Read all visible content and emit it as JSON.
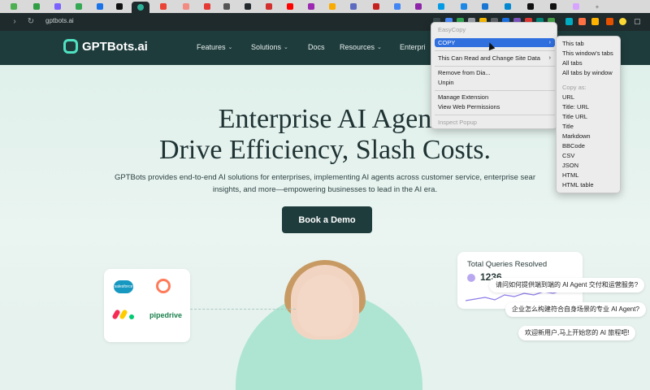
{
  "browser": {
    "url": "gptbots.ai",
    "colors": {
      "tabstrip": "#d9d9d9",
      "toolbar": "#1f2a2c",
      "active_tab_icon": "#2bb39a"
    }
  },
  "site": {
    "logo_text": "GPTBots.ai",
    "nav": [
      {
        "label": "Features",
        "has_dropdown": true
      },
      {
        "label": "Solutions",
        "has_dropdown": true
      },
      {
        "label": "Docs",
        "has_dropdown": false
      },
      {
        "label": "Resources",
        "has_dropdown": true
      },
      {
        "label": "Enterpri",
        "has_dropdown": false
      }
    ],
    "hero": {
      "title_line1": "Enterprise AI Agen",
      "title_line2": "Drive Efficiency, Slash Costs.",
      "subtitle_line1": "GPTBots provides end-to-end AI solutions for enterprises, implementing AI agents across customer service, enterprise sear",
      "subtitle_line2": "insights, and more—empowering businesses to lead in the AI era.",
      "cta": "Book a Demo"
    },
    "logos": [
      "salesforce",
      "pipedrive"
    ],
    "queries_card": {
      "title": "Total Queries Resolved",
      "value": "1236"
    },
    "chat_bubbles": [
      "请问如何提供端到端的 AI Agent 交付和运营服务?",
      "企业怎么构建符合自身场景的专业 AI Agent?",
      "欢迎新用户,马上开始您的 AI 旅程吧!"
    ],
    "colors": {
      "header": "#1f3c3c",
      "accent": "#4fe2c2",
      "cta": "#1f3c3c"
    }
  },
  "context_menu": {
    "title": "EasyCopy",
    "items": [
      {
        "label": "COPY",
        "type": "submenu",
        "highlight": true
      },
      {
        "label": "This Can Read and Change Site Data",
        "type": "submenu"
      },
      {
        "label": "Remove from Dia...",
        "type": "item"
      },
      {
        "label": "Unpin",
        "type": "item"
      },
      {
        "label": "Manage Extension",
        "type": "item"
      },
      {
        "label": "View Web Permissions",
        "type": "item"
      },
      {
        "label": "Inspect Popup",
        "type": "disabled"
      }
    ]
  },
  "copy_submenu": {
    "items": [
      {
        "label": "This tab",
        "type": "item"
      },
      {
        "label": "This window's tabs",
        "type": "item"
      },
      {
        "label": "All tabs",
        "type": "item"
      },
      {
        "label": "All tabs by window",
        "type": "item"
      },
      {
        "label": "Copy as:",
        "type": "disabled"
      },
      {
        "label": "URL",
        "type": "item"
      },
      {
        "label": "Title: URL",
        "type": "item"
      },
      {
        "label": "Title  URL",
        "type": "item"
      },
      {
        "label": "Title",
        "type": "item"
      },
      {
        "label": "Markdown",
        "type": "item"
      },
      {
        "label": "BBCode",
        "type": "item"
      },
      {
        "label": "CSV",
        "type": "item"
      },
      {
        "label": "JSON",
        "type": "item"
      },
      {
        "label": "HTML",
        "type": "item"
      },
      {
        "label": "HTML table",
        "type": "item"
      }
    ]
  }
}
